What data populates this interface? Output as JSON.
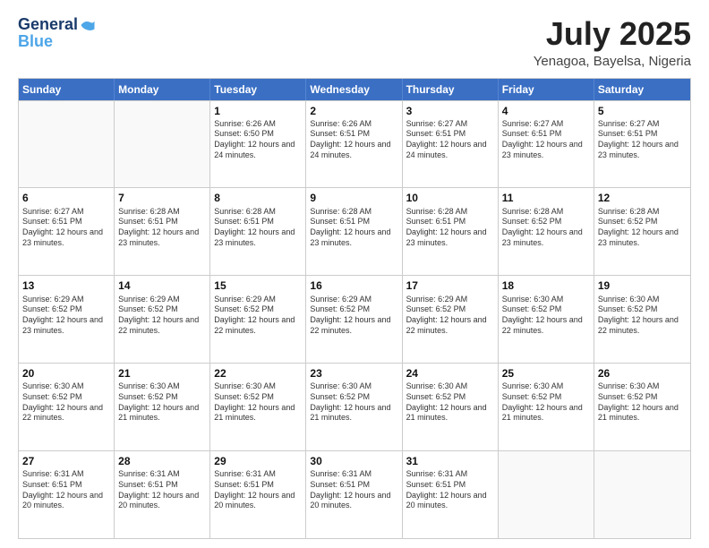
{
  "header": {
    "logo_line1": "General",
    "logo_line2": "Blue",
    "title": "July 2025",
    "subtitle": "Yenagoa, Bayelsa, Nigeria"
  },
  "calendar": {
    "days_of_week": [
      "Sunday",
      "Monday",
      "Tuesday",
      "Wednesday",
      "Thursday",
      "Friday",
      "Saturday"
    ],
    "weeks": [
      [
        {
          "day": "",
          "empty": true
        },
        {
          "day": "",
          "empty": true
        },
        {
          "day": "1",
          "sunrise": "6:26 AM",
          "sunset": "6:50 PM",
          "daylight": "12 hours and 24 minutes."
        },
        {
          "day": "2",
          "sunrise": "6:26 AM",
          "sunset": "6:51 PM",
          "daylight": "12 hours and 24 minutes."
        },
        {
          "day": "3",
          "sunrise": "6:27 AM",
          "sunset": "6:51 PM",
          "daylight": "12 hours and 24 minutes."
        },
        {
          "day": "4",
          "sunrise": "6:27 AM",
          "sunset": "6:51 PM",
          "daylight": "12 hours and 23 minutes."
        },
        {
          "day": "5",
          "sunrise": "6:27 AM",
          "sunset": "6:51 PM",
          "daylight": "12 hours and 23 minutes."
        }
      ],
      [
        {
          "day": "6",
          "sunrise": "6:27 AM",
          "sunset": "6:51 PM",
          "daylight": "12 hours and 23 minutes."
        },
        {
          "day": "7",
          "sunrise": "6:28 AM",
          "sunset": "6:51 PM",
          "daylight": "12 hours and 23 minutes."
        },
        {
          "day": "8",
          "sunrise": "6:28 AM",
          "sunset": "6:51 PM",
          "daylight": "12 hours and 23 minutes."
        },
        {
          "day": "9",
          "sunrise": "6:28 AM",
          "sunset": "6:51 PM",
          "daylight": "12 hours and 23 minutes."
        },
        {
          "day": "10",
          "sunrise": "6:28 AM",
          "sunset": "6:51 PM",
          "daylight": "12 hours and 23 minutes."
        },
        {
          "day": "11",
          "sunrise": "6:28 AM",
          "sunset": "6:52 PM",
          "daylight": "12 hours and 23 minutes."
        },
        {
          "day": "12",
          "sunrise": "6:28 AM",
          "sunset": "6:52 PM",
          "daylight": "12 hours and 23 minutes."
        }
      ],
      [
        {
          "day": "13",
          "sunrise": "6:29 AM",
          "sunset": "6:52 PM",
          "daylight": "12 hours and 23 minutes."
        },
        {
          "day": "14",
          "sunrise": "6:29 AM",
          "sunset": "6:52 PM",
          "daylight": "12 hours and 22 minutes."
        },
        {
          "day": "15",
          "sunrise": "6:29 AM",
          "sunset": "6:52 PM",
          "daylight": "12 hours and 22 minutes."
        },
        {
          "day": "16",
          "sunrise": "6:29 AM",
          "sunset": "6:52 PM",
          "daylight": "12 hours and 22 minutes."
        },
        {
          "day": "17",
          "sunrise": "6:29 AM",
          "sunset": "6:52 PM",
          "daylight": "12 hours and 22 minutes."
        },
        {
          "day": "18",
          "sunrise": "6:30 AM",
          "sunset": "6:52 PM",
          "daylight": "12 hours and 22 minutes."
        },
        {
          "day": "19",
          "sunrise": "6:30 AM",
          "sunset": "6:52 PM",
          "daylight": "12 hours and 22 minutes."
        }
      ],
      [
        {
          "day": "20",
          "sunrise": "6:30 AM",
          "sunset": "6:52 PM",
          "daylight": "12 hours and 22 minutes."
        },
        {
          "day": "21",
          "sunrise": "6:30 AM",
          "sunset": "6:52 PM",
          "daylight": "12 hours and 21 minutes."
        },
        {
          "day": "22",
          "sunrise": "6:30 AM",
          "sunset": "6:52 PM",
          "daylight": "12 hours and 21 minutes."
        },
        {
          "day": "23",
          "sunrise": "6:30 AM",
          "sunset": "6:52 PM",
          "daylight": "12 hours and 21 minutes."
        },
        {
          "day": "24",
          "sunrise": "6:30 AM",
          "sunset": "6:52 PM",
          "daylight": "12 hours and 21 minutes."
        },
        {
          "day": "25",
          "sunrise": "6:30 AM",
          "sunset": "6:52 PM",
          "daylight": "12 hours and 21 minutes."
        },
        {
          "day": "26",
          "sunrise": "6:30 AM",
          "sunset": "6:52 PM",
          "daylight": "12 hours and 21 minutes."
        }
      ],
      [
        {
          "day": "27",
          "sunrise": "6:31 AM",
          "sunset": "6:51 PM",
          "daylight": "12 hours and 20 minutes."
        },
        {
          "day": "28",
          "sunrise": "6:31 AM",
          "sunset": "6:51 PM",
          "daylight": "12 hours and 20 minutes."
        },
        {
          "day": "29",
          "sunrise": "6:31 AM",
          "sunset": "6:51 PM",
          "daylight": "12 hours and 20 minutes."
        },
        {
          "day": "30",
          "sunrise": "6:31 AM",
          "sunset": "6:51 PM",
          "daylight": "12 hours and 20 minutes."
        },
        {
          "day": "31",
          "sunrise": "6:31 AM",
          "sunset": "6:51 PM",
          "daylight": "12 hours and 20 minutes."
        },
        {
          "day": "",
          "empty": true
        },
        {
          "day": "",
          "empty": true
        }
      ]
    ]
  }
}
